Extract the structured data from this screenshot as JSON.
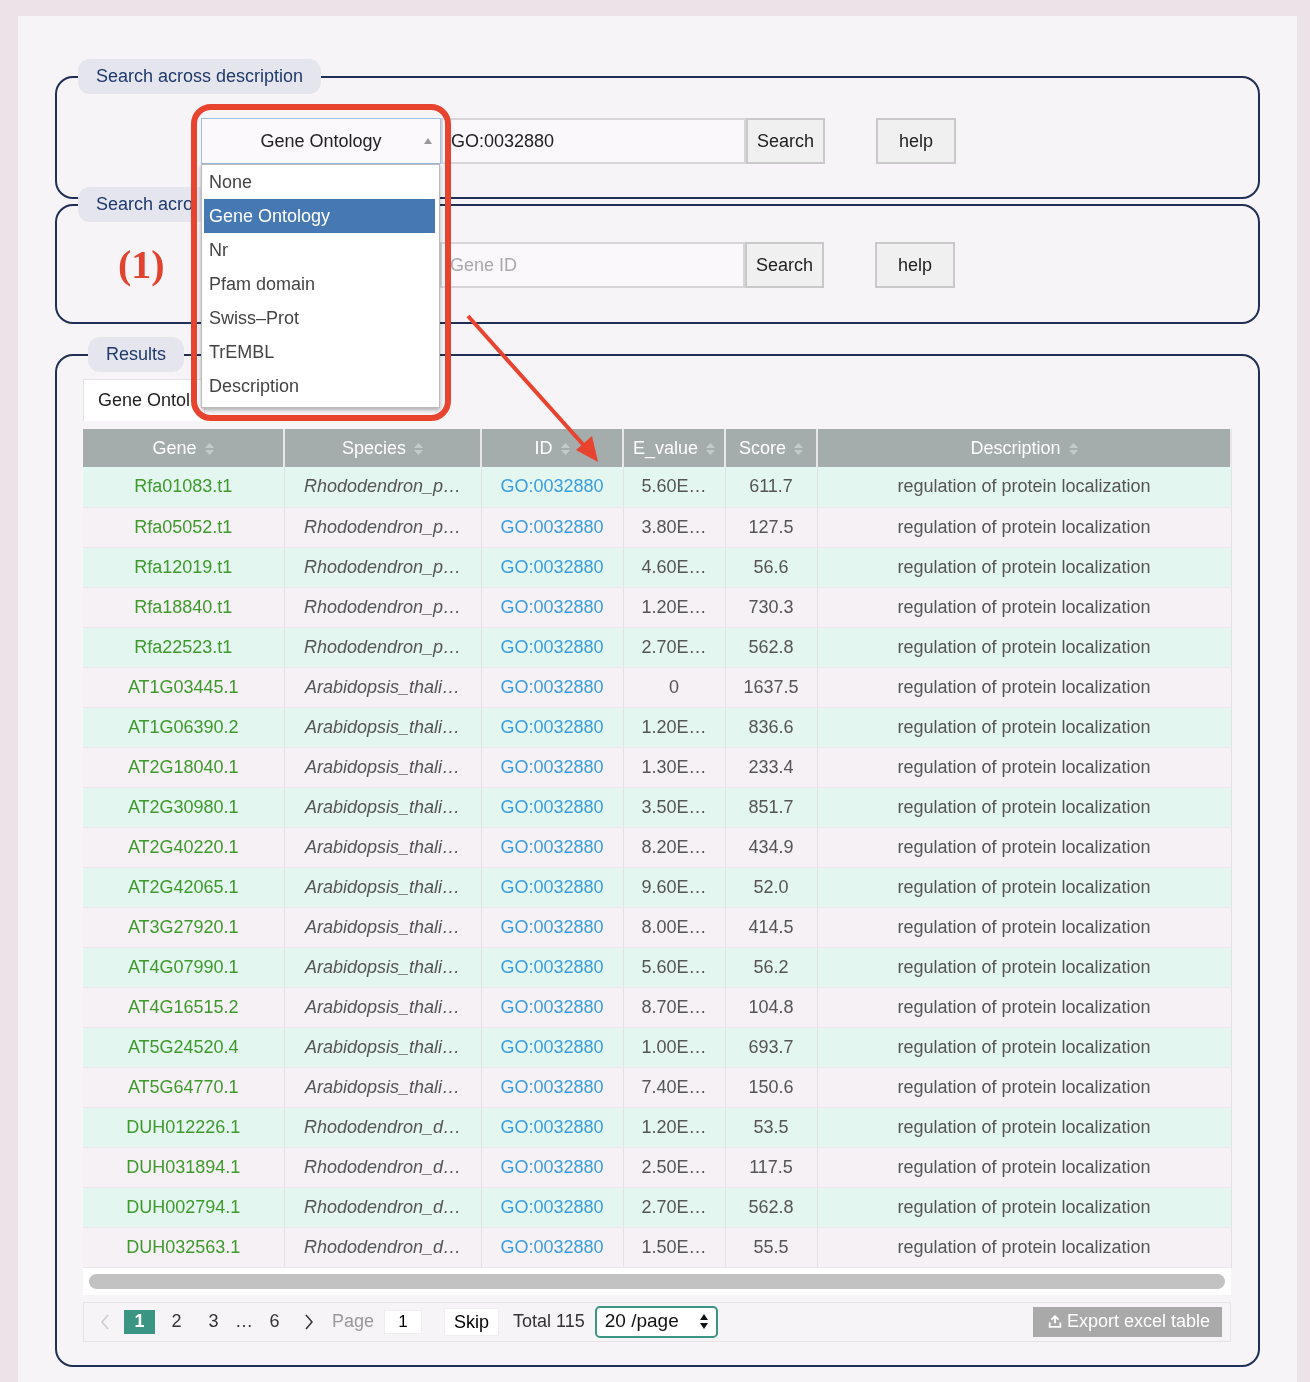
{
  "search_panels": [
    {
      "legend": "Search across description",
      "input": {
        "value": "GO:0032880"
      },
      "buttons": [
        "Search",
        "help"
      ]
    },
    {
      "legend": "Search acro",
      "input": {
        "placeholder": "Gene ID"
      },
      "buttons": [
        "Search",
        "help"
      ]
    }
  ],
  "dropdown": {
    "value": "Gene Ontology",
    "options": [
      {
        "label": "None",
        "selected": false
      },
      {
        "label": "Gene Ontology",
        "selected": true
      },
      {
        "label": "Nr",
        "selected": false
      },
      {
        "label": "Pfam domain",
        "selected": false
      },
      {
        "label": "Swiss‒Prot",
        "selected": false
      },
      {
        "label": "TrEMBL",
        "selected": false
      },
      {
        "label": "Description",
        "selected": false
      }
    ]
  },
  "annotation": {
    "label": "(1)"
  },
  "results": {
    "legend": "Results",
    "tabs": [
      {
        "label": "Gene Ontol",
        "selected": true
      }
    ],
    "table": {
      "columns": [
        "Gene",
        "Species",
        "ID",
        "E_value",
        "Score",
        "Description"
      ],
      "rows": [
        {
          "gene": "Rfa01083.t1",
          "species": "Rhododendron_p…",
          "id": "GO:0032880",
          "e_value": "5.60E…",
          "score": "611.7",
          "description": "regulation of protein localization"
        },
        {
          "gene": "Rfa05052.t1",
          "species": "Rhododendron_p…",
          "id": "GO:0032880",
          "e_value": "3.80E…",
          "score": "127.5",
          "description": "regulation of protein localization"
        },
        {
          "gene": "Rfa12019.t1",
          "species": "Rhododendron_p…",
          "id": "GO:0032880",
          "e_value": "4.60E…",
          "score": "56.6",
          "description": "regulation of protein localization"
        },
        {
          "gene": "Rfa18840.t1",
          "species": "Rhododendron_p…",
          "id": "GO:0032880",
          "e_value": "1.20E…",
          "score": "730.3",
          "description": "regulation of protein localization"
        },
        {
          "gene": "Rfa22523.t1",
          "species": "Rhododendron_p…",
          "id": "GO:0032880",
          "e_value": "2.70E…",
          "score": "562.8",
          "description": "regulation of protein localization"
        },
        {
          "gene": "AT1G03445.1",
          "species": "Arabidopsis_thali…",
          "id": "GO:0032880",
          "e_value": "0",
          "score": "1637.5",
          "description": "regulation of protein localization"
        },
        {
          "gene": "AT1G06390.2",
          "species": "Arabidopsis_thali…",
          "id": "GO:0032880",
          "e_value": "1.20E…",
          "score": "836.6",
          "description": "regulation of protein localization"
        },
        {
          "gene": "AT2G18040.1",
          "species": "Arabidopsis_thali…",
          "id": "GO:0032880",
          "e_value": "1.30E…",
          "score": "233.4",
          "description": "regulation of protein localization"
        },
        {
          "gene": "AT2G30980.1",
          "species": "Arabidopsis_thali…",
          "id": "GO:0032880",
          "e_value": "3.50E…",
          "score": "851.7",
          "description": "regulation of protein localization"
        },
        {
          "gene": "AT2G40220.1",
          "species": "Arabidopsis_thali…",
          "id": "GO:0032880",
          "e_value": "8.20E…",
          "score": "434.9",
          "description": "regulation of protein localization"
        },
        {
          "gene": "AT2G42065.1",
          "species": "Arabidopsis_thali…",
          "id": "GO:0032880",
          "e_value": "9.60E…",
          "score": "52.0",
          "description": "regulation of protein localization"
        },
        {
          "gene": "AT3G27920.1",
          "species": "Arabidopsis_thali…",
          "id": "GO:0032880",
          "e_value": "8.00E…",
          "score": "414.5",
          "description": "regulation of protein localization"
        },
        {
          "gene": "AT4G07990.1",
          "species": "Arabidopsis_thali…",
          "id": "GO:0032880",
          "e_value": "5.60E…",
          "score": "56.2",
          "description": "regulation of protein localization"
        },
        {
          "gene": "AT4G16515.2",
          "species": "Arabidopsis_thali…",
          "id": "GO:0032880",
          "e_value": "8.70E…",
          "score": "104.8",
          "description": "regulation of protein localization"
        },
        {
          "gene": "AT5G24520.4",
          "species": "Arabidopsis_thali…",
          "id": "GO:0032880",
          "e_value": "1.00E…",
          "score": "693.7",
          "description": "regulation of protein localization"
        },
        {
          "gene": "AT5G64770.1",
          "species": "Arabidopsis_thali…",
          "id": "GO:0032880",
          "e_value": "7.40E…",
          "score": "150.6",
          "description": "regulation of protein localization"
        },
        {
          "gene": "DUH012226.1",
          "species": "Rhododendron_d…",
          "id": "GO:0032880",
          "e_value": "1.20E…",
          "score": "53.5",
          "description": "regulation of protein localization"
        },
        {
          "gene": "DUH031894.1",
          "species": "Rhododendron_d…",
          "id": "GO:0032880",
          "e_value": "2.50E…",
          "score": "117.5",
          "description": "regulation of protein localization"
        },
        {
          "gene": "DUH002794.1",
          "species": "Rhododendron_d…",
          "id": "GO:0032880",
          "e_value": "2.70E…",
          "score": "562.8",
          "description": "regulation of protein localization"
        },
        {
          "gene": "DUH032563.1",
          "species": "Rhododendron_d…",
          "id": "GO:0032880",
          "e_value": "1.50E…",
          "score": "55.5",
          "description": "regulation of protein localization"
        }
      ]
    },
    "pagination": {
      "prev_disabled": true,
      "pages": [
        {
          "label": "1",
          "selected": true,
          "kind": "page"
        },
        {
          "label": "2",
          "selected": false,
          "kind": "page"
        },
        {
          "label": "3",
          "selected": false,
          "kind": "page"
        },
        {
          "label": "…",
          "kind": "gap"
        },
        {
          "label": "6",
          "selected": false,
          "kind": "page"
        }
      ],
      "goto_label": "Page",
      "goto_value": "1",
      "skip": "Skip",
      "total": "Total 115",
      "page_size": "20 /page",
      "export": "Export excel table"
    }
  }
}
